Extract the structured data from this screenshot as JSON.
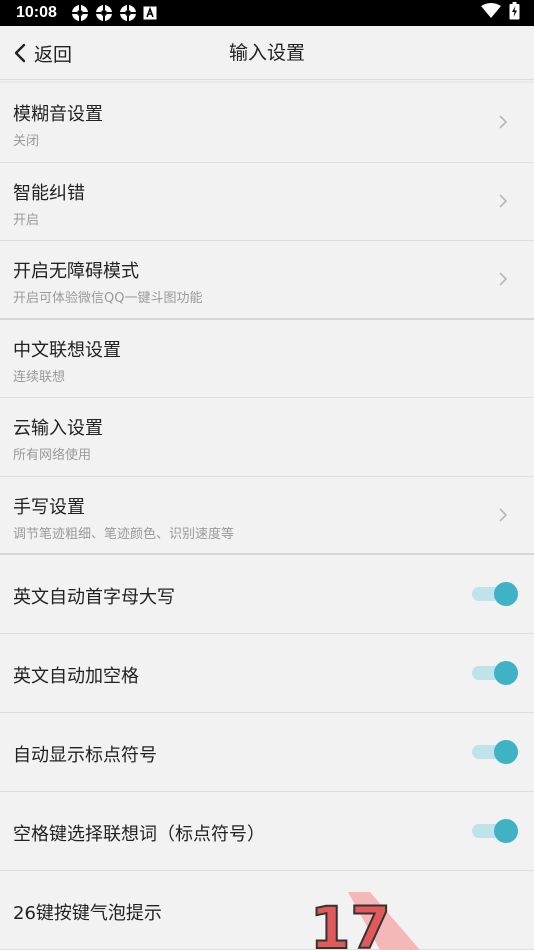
{
  "status_bar": {
    "time": "10:08",
    "left_icons": [
      "settings-gear-icon",
      "settings-gear-icon",
      "settings-gear-icon",
      "keyboard-a-icon"
    ],
    "right_icons": [
      "wifi-icon",
      "battery-charging-icon"
    ]
  },
  "header": {
    "back_label": "返回",
    "title": "输入设置"
  },
  "settings": [
    {
      "title": "模糊音设置",
      "subtitle": "关闭",
      "control": "chevron"
    },
    {
      "title": "智能纠错",
      "subtitle": "开启",
      "control": "chevron"
    },
    {
      "title": "开启无障碍模式",
      "subtitle": "开启可体验微信QQ一键斗图功能",
      "control": "chevron"
    },
    {
      "title": "中文联想设置",
      "subtitle": "连续联想",
      "control": "none"
    },
    {
      "title": "云输入设置",
      "subtitle": "所有网络使用",
      "control": "none"
    },
    {
      "title": "手写设置",
      "subtitle": "调节笔迹粗细、笔迹颜色、识别速度等",
      "control": "chevron"
    },
    {
      "title": "英文自动首字母大写",
      "control": "toggle",
      "on": true
    },
    {
      "title": "英文自动加空格",
      "control": "toggle",
      "on": true
    },
    {
      "title": "自动显示标点符号",
      "control": "toggle",
      "on": true
    },
    {
      "title": "空格键选择联想词（标点符号）",
      "control": "toggle",
      "on": true
    },
    {
      "title": "26键按键气泡提示",
      "control": "none"
    }
  ],
  "colors": {
    "accent": "#3fb2c6",
    "accent_track": "#bfe3ea",
    "background": "#f2f2f2",
    "watermark": "#e05a5a"
  },
  "watermark": {
    "text": "17"
  }
}
